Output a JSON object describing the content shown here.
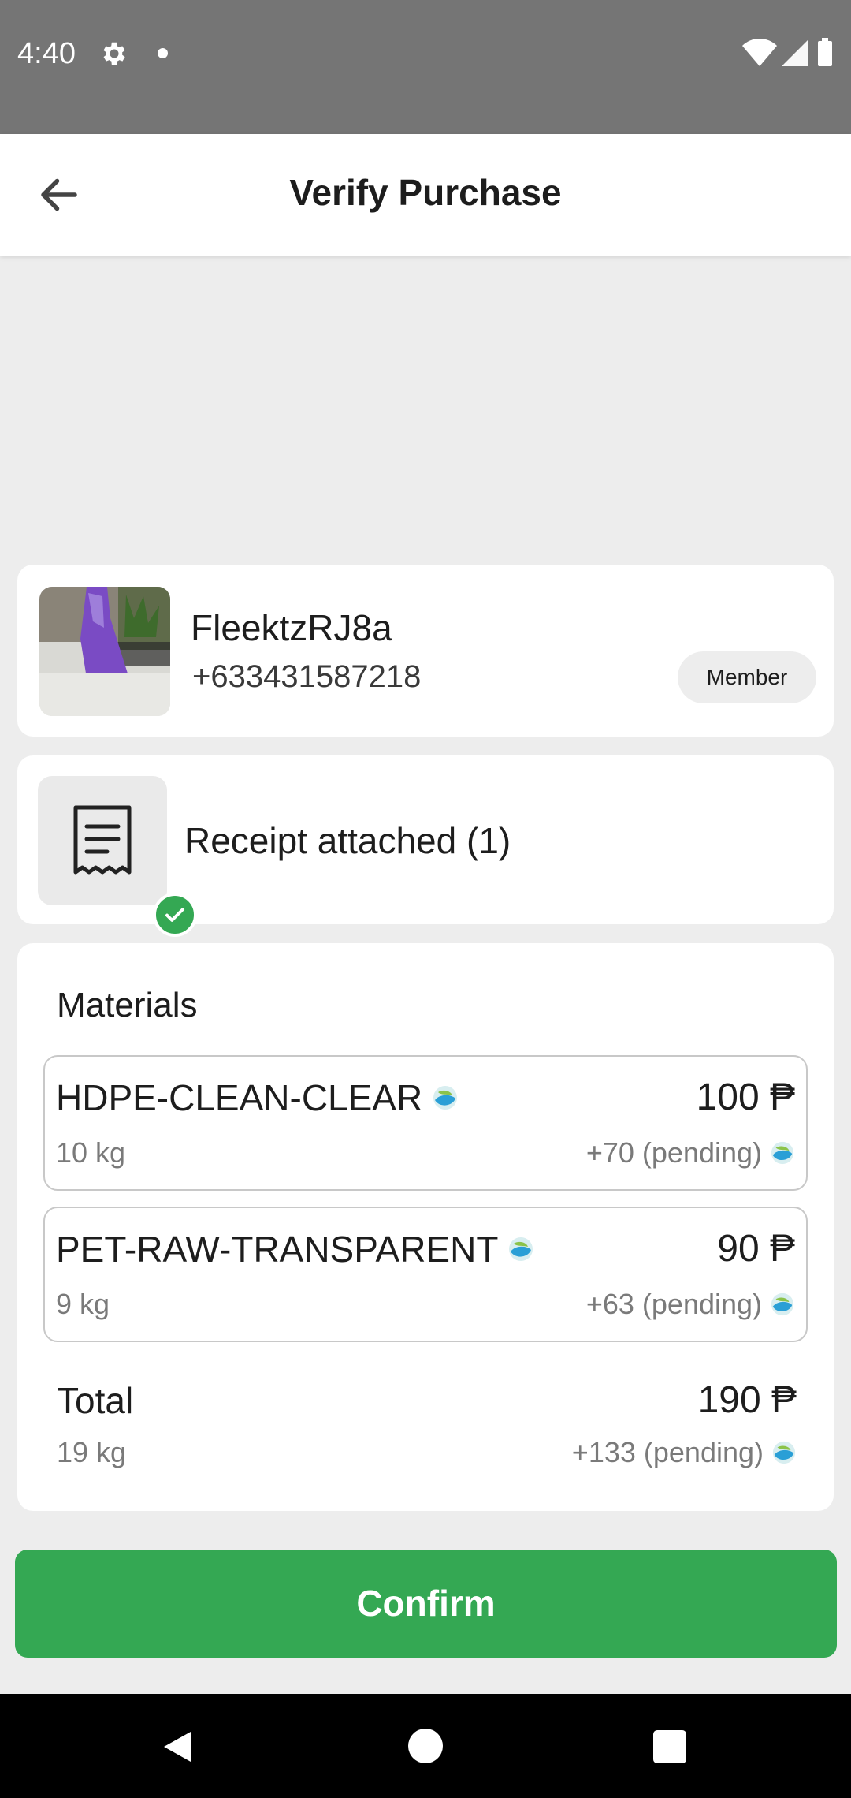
{
  "status_bar": {
    "time": "4:40"
  },
  "app_bar": {
    "title": "Verify Purchase"
  },
  "user": {
    "name": "FleektzRJ8a",
    "phone": "+633431587218",
    "role_badge": "Member"
  },
  "receipt": {
    "label": "Receipt attached (1)"
  },
  "materials": {
    "heading": "Materials",
    "items": [
      {
        "name": "HDPE-CLEAN-CLEAR",
        "price": "100 ₱",
        "weight": "10 kg",
        "pending": "+70 (pending)"
      },
      {
        "name": "PET-RAW-TRANSPARENT",
        "price": "90 ₱",
        "weight": "9 kg",
        "pending": "+63 (pending)"
      }
    ],
    "total": {
      "label": "Total",
      "price": "190 ₱",
      "weight": "19 kg",
      "pending": "+133 (pending)"
    }
  },
  "confirm_button": {
    "label": "Confirm"
  },
  "colors": {
    "accent_green": "#34a853",
    "status_bar": "#757575",
    "background": "#ededed"
  },
  "icons": {
    "back": "arrow-left",
    "settings": "gear",
    "receipt": "receipt",
    "check": "check-circle",
    "coin": "eco-coin",
    "wifi": "wifi",
    "signal": "cell-signal",
    "battery": "battery"
  }
}
